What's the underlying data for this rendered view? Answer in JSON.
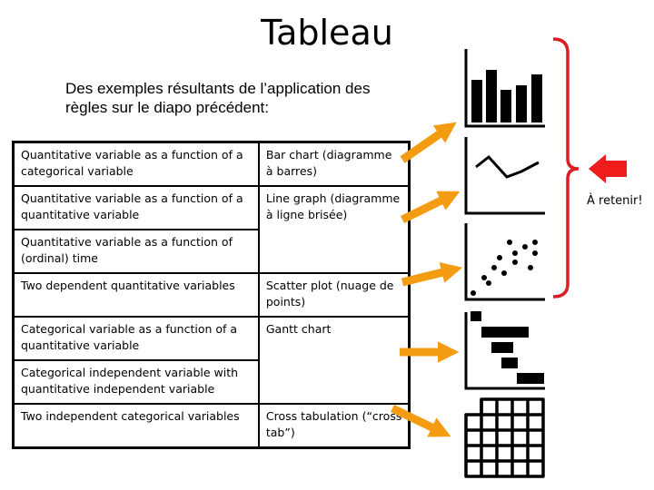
{
  "slide": {
    "title": "Tableau",
    "subtitle": "Des exemples résultants de l’application des règles sur le diapo précédent:"
  },
  "table": {
    "rows": [
      {
        "condition": "Quantitative variable as a function of a categorical variable",
        "chart": "Bar chart (diagramme à barres)"
      },
      {
        "condition": "Quantitative variable as a function of a quantitative variable",
        "chart": "Line graph (diagramme à ligne brisée)"
      },
      {
        "condition": "Quantitative variable as a function of (ordinal) time",
        "chart": null
      },
      {
        "condition": "Two dependent quantitative variables",
        "chart": "Scatter plot (nuage de points)"
      },
      {
        "condition": "Categorical variable as a function of a quantitative variable",
        "chart": "Gantt chart"
      },
      {
        "condition": "Categorical independent variable with quantitative independent variable",
        "chart": null
      },
      {
        "condition": "Two independent categorical variables",
        "chart": "Cross tabulation (“cross tab”)"
      }
    ]
  },
  "icons": [
    {
      "name": "bar-chart-icon",
      "depicts": "bar chart"
    },
    {
      "name": "line-graph-icon",
      "depicts": "line graph"
    },
    {
      "name": "scatter-plot-icon",
      "depicts": "scatter plot"
    },
    {
      "name": "gantt-chart-icon",
      "depicts": "gantt chart"
    },
    {
      "name": "cross-tab-icon",
      "depicts": "cross tabulation grid"
    }
  ],
  "annotation": {
    "label": "À retenir!",
    "brace_covers": [
      "Bar chart",
      "Line graph",
      "Scatter plot"
    ]
  },
  "colors": {
    "arrow": "#f39c12",
    "brace": "#d81f26",
    "pointer": "#ee1c1c",
    "ink": "#000000"
  }
}
